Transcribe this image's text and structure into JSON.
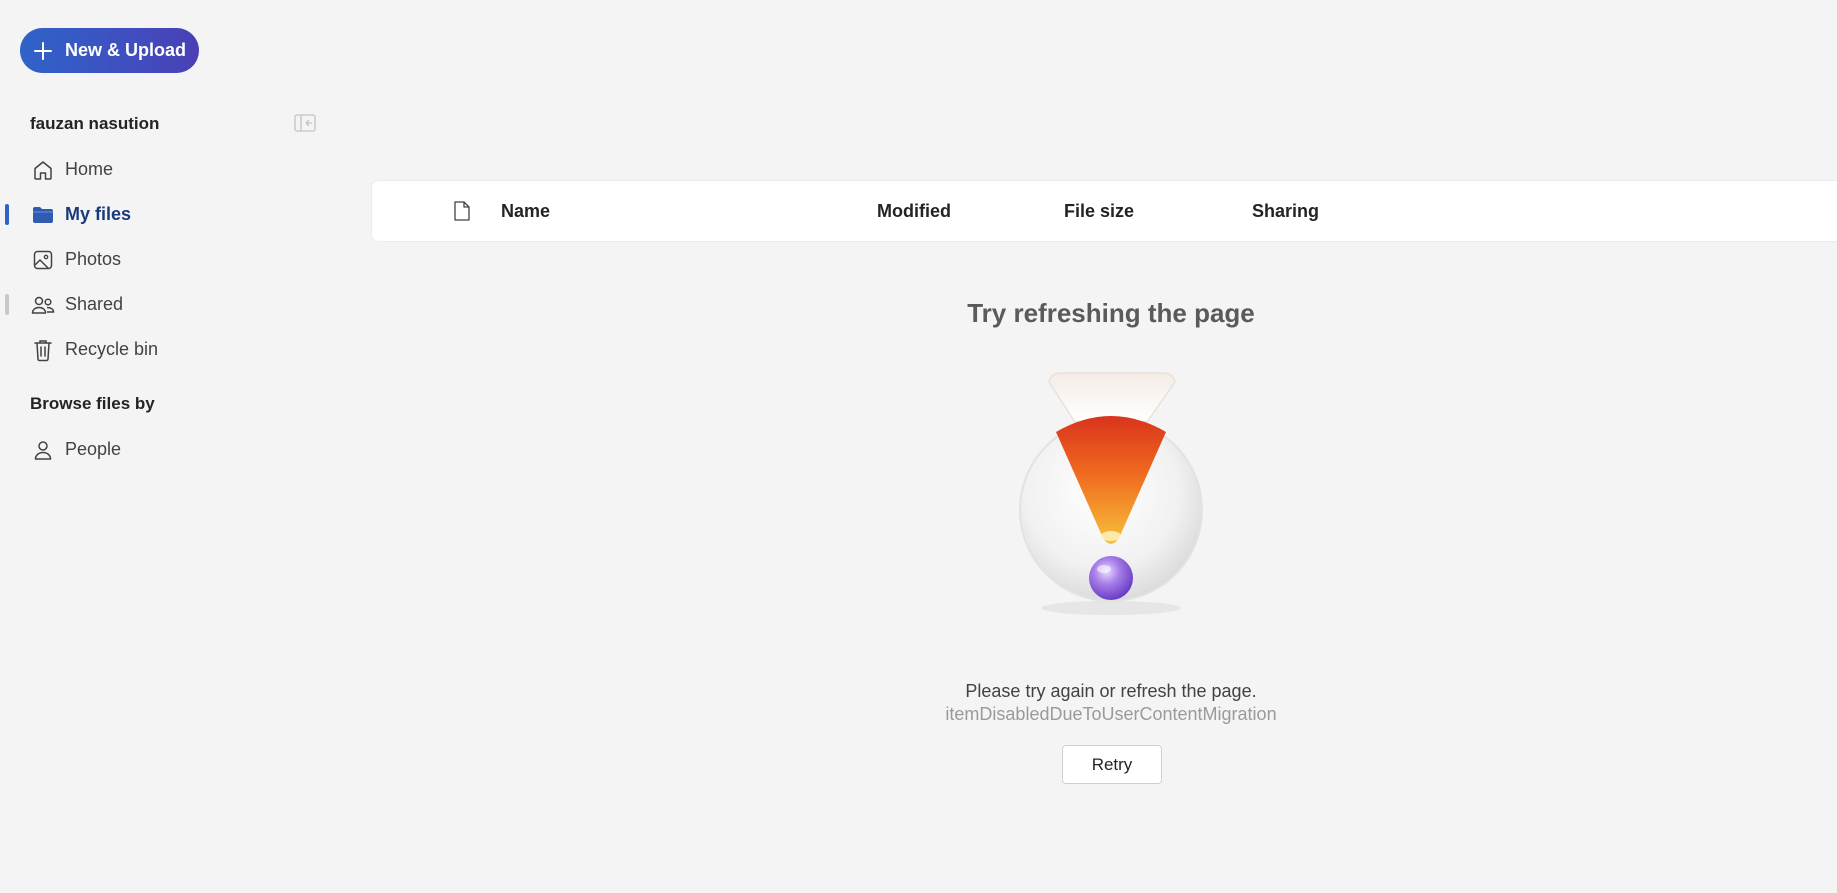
{
  "toolbar": {
    "new_upload_label": "New & Upload"
  },
  "sidebar": {
    "user_name": "fauzan nasution",
    "items": [
      {
        "label": "Home",
        "icon": "home-icon"
      },
      {
        "label": "My files",
        "icon": "folder-icon",
        "active": true
      },
      {
        "label": "Photos",
        "icon": "image-icon"
      },
      {
        "label": "Shared",
        "icon": "people-icon"
      },
      {
        "label": "Recycle bin",
        "icon": "trash-icon"
      }
    ],
    "browse_title": "Browse files by",
    "browse_items": [
      {
        "label": "People",
        "icon": "person-icon"
      }
    ]
  },
  "list": {
    "columns": {
      "name": "Name",
      "modified": "Modified",
      "file_size": "File size",
      "sharing": "Sharing"
    }
  },
  "error": {
    "title": "Try refreshing the page",
    "message": "Please try again or refresh the page.",
    "code": "itemDisabledDueToUserContentMigration",
    "retry_label": "Retry"
  },
  "colors": {
    "accent": "#2f63c9",
    "background": "#f4f4f4"
  }
}
